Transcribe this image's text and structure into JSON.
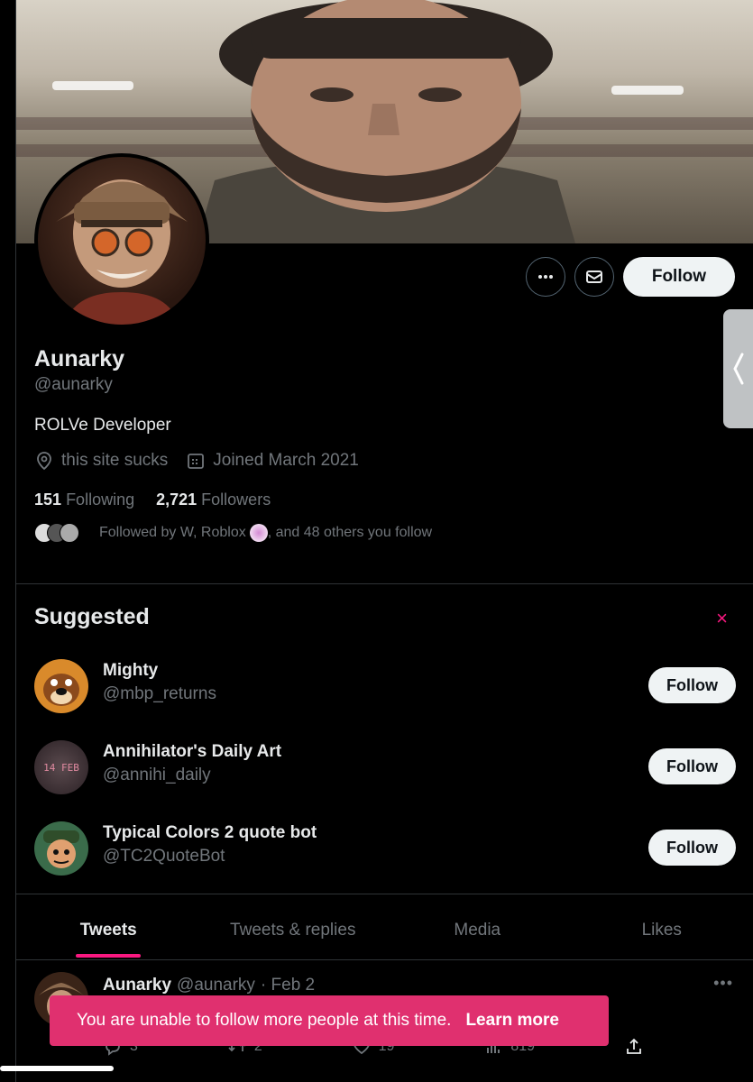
{
  "profile": {
    "name": "Aunarky",
    "handle": "@aunarky",
    "bio": "ROLVe Developer",
    "location": "this site sucks",
    "joined": "Joined March 2021",
    "following_count": "151",
    "following_label": "Following",
    "followers_count": "2,721",
    "followers_label": "Followers",
    "followed_by_a": "Followed by W, Roblox",
    "followed_by_b": ", and 48 others you follow",
    "follow_label": "Follow"
  },
  "suggested": {
    "title": "Suggested",
    "close_icon": "×",
    "items": [
      {
        "name": "Mighty",
        "handle": "@mbp_returns",
        "follow": "Follow"
      },
      {
        "name": "Annihilator's Daily Art",
        "handle": "@annihi_daily",
        "follow": "Follow",
        "avatar_text": "14 FEB"
      },
      {
        "name": "Typical Colors 2 quote bot",
        "handle": "@TC2QuoteBot",
        "follow": "Follow"
      }
    ]
  },
  "tabs": [
    "Tweets",
    "Tweets & replies",
    "Media",
    "Likes"
  ],
  "active_tab": "Tweets",
  "tweet": {
    "name": "Aunarky",
    "handle": "@aunarky",
    "date": "· Feb 2",
    "more": "•••",
    "replies": "3",
    "retweets": "2",
    "likes": "19",
    "views": "819"
  },
  "toast": {
    "message": "You are unable to follow more people at this time.",
    "link": "Learn more"
  },
  "colors": {
    "accent": "#f91880",
    "toast": "#e0306f",
    "muted": "#71767b"
  },
  "icons": [
    "more-icon",
    "mail-icon",
    "location-icon",
    "calendar-icon",
    "close-icon",
    "reply-icon",
    "retweet-icon",
    "like-icon",
    "views-icon",
    "share-icon",
    "chevron-left-icon"
  ]
}
